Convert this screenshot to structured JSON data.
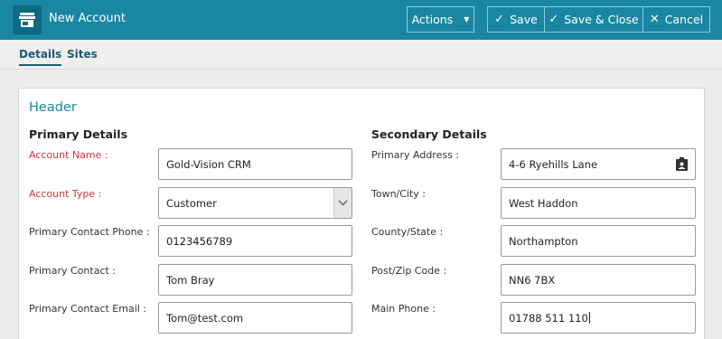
{
  "window": {
    "title": "New Account",
    "app_icon": "store-icon"
  },
  "toolbar": {
    "actions_label": "Actions",
    "save_label": "Save",
    "save_close_label": "Save & Close",
    "cancel_label": "Cancel"
  },
  "tabs": [
    {
      "label": "Details",
      "active": true
    },
    {
      "label": "Sites",
      "active": false
    }
  ],
  "form": {
    "section_title": "Header",
    "primary": {
      "heading": "Primary Details",
      "account_name": {
        "label": "Account Name :",
        "value": "Gold-Vision CRM",
        "required": true
      },
      "account_type": {
        "label": "Account Type :",
        "value": "Customer",
        "required": true
      },
      "contact_phone": {
        "label": "Primary Contact Phone :",
        "value": "0123456789"
      },
      "contact": {
        "label": "Primary Contact :",
        "value": "Tom Bray"
      },
      "contact_email": {
        "label": "Primary Contact Email :",
        "value": "Tom@test.com"
      }
    },
    "secondary": {
      "heading": "Secondary Details",
      "address": {
        "label": "Primary Address :",
        "value": "4-6 Ryehills Lane"
      },
      "town": {
        "label": "Town/City :",
        "value": "West Haddon"
      },
      "county": {
        "label": "County/State :",
        "value": "Northampton"
      },
      "postcode": {
        "label": "Post/Zip Code :",
        "value": "NN6 7BX"
      },
      "main_phone": {
        "label": "Main Phone :",
        "value": "01788 511 110"
      }
    }
  },
  "colors": {
    "brand": "#1a87a2",
    "required": "#d8353b",
    "tab_active": "#1d5b74"
  }
}
